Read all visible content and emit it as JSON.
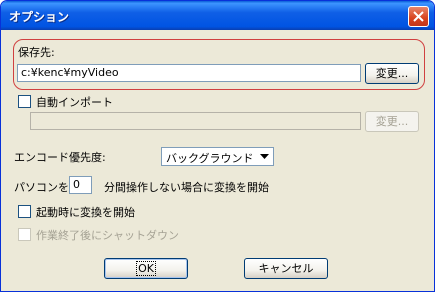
{
  "window": {
    "title": "オプション"
  },
  "save": {
    "label": "保存先:",
    "path": "c:¥kenc¥myVideo",
    "change_label": "変更..."
  },
  "auto_import": {
    "label": "自動インポート",
    "path": "",
    "change_label": "変更..."
  },
  "encode_priority": {
    "label": "エンコード優先度:",
    "selected": "バックグラウンド"
  },
  "idle": {
    "prefix": "パソコンを",
    "minutes": "0",
    "suffix": "分間操作しない場合に変換を開始"
  },
  "startup_convert": {
    "label": "起動時に変換を開始"
  },
  "shutdown_after": {
    "label": "作業終了後にシャットダウン"
  },
  "buttons": {
    "ok": "OK",
    "cancel": "キャンセル"
  }
}
